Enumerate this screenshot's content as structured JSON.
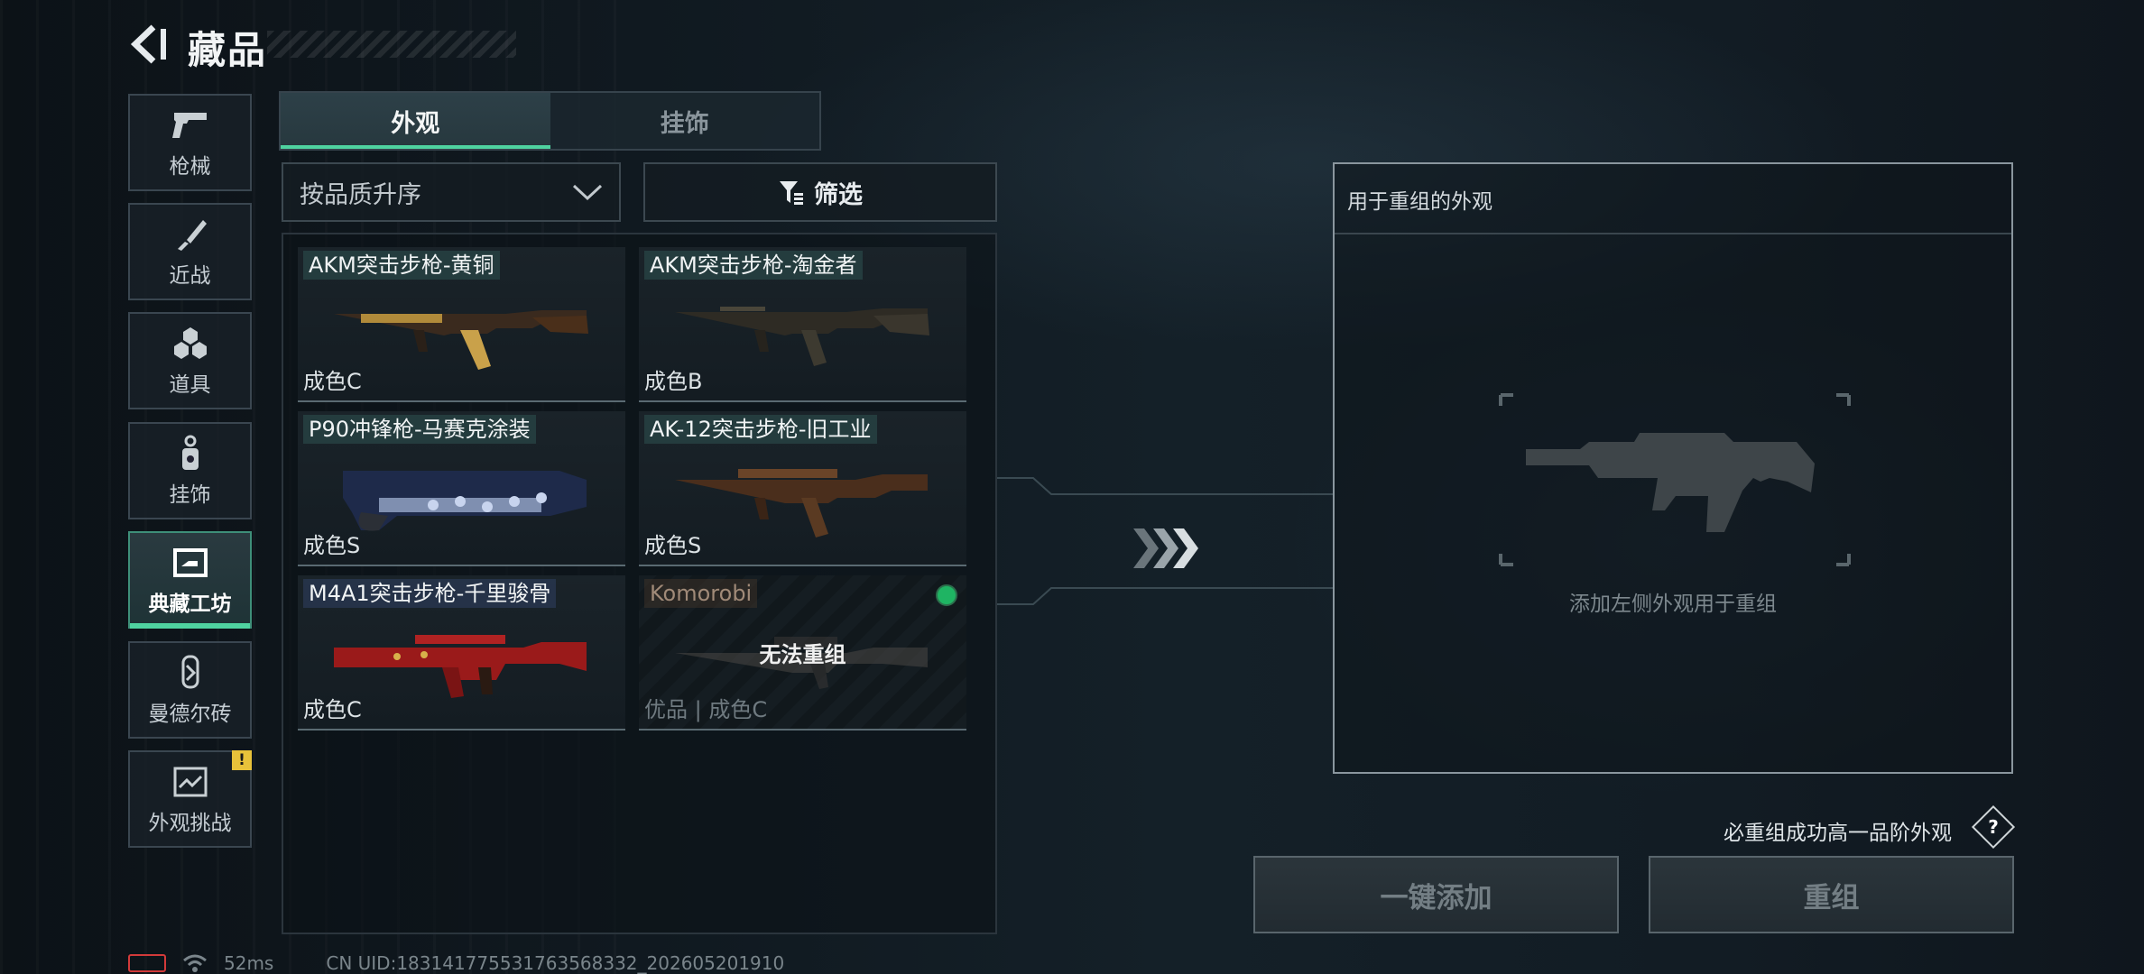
{
  "header": {
    "title": "藏品"
  },
  "sidebar": {
    "items": [
      {
        "label": "枪械",
        "icon": "pistol-icon"
      },
      {
        "label": "近战",
        "icon": "knife-icon"
      },
      {
        "label": "道具",
        "icon": "grenades-icon"
      },
      {
        "label": "挂饰",
        "icon": "charm-icon"
      },
      {
        "label": "典藏工坊",
        "icon": "workshop-icon",
        "active": true
      },
      {
        "label": "曼德尔砖",
        "icon": "mandel-brick-icon"
      },
      {
        "label": "外观挑战",
        "icon": "challenge-icon",
        "badge": "!"
      }
    ]
  },
  "tabs": [
    {
      "label": "外观",
      "active": true
    },
    {
      "label": "挂饰"
    }
  ],
  "sort": {
    "label": "按品质升序"
  },
  "filter": {
    "label": "筛选"
  },
  "items": [
    {
      "name": "AKM突击步枪-黄铜",
      "grade": "成色C"
    },
    {
      "name": "AKM突击步枪-淘金者",
      "grade": "成色B"
    },
    {
      "name": "P90冲锋枪-马赛克涂装",
      "grade": "成色S"
    },
    {
      "name": "AK-12突击步枪-旧工业",
      "grade": "成色S"
    },
    {
      "name": "M4A1突击步枪-千里骏骨",
      "grade": "成色C"
    },
    {
      "name": "Komorobi",
      "grade": "优品 | 成色C",
      "overlay": "无法重组"
    }
  ],
  "recombine": {
    "title": "用于重组的外观",
    "hint": "添加左侧外观用于重组",
    "upgrade_note": "必重组成功高一品阶外观",
    "help": "?",
    "add_all": "一键添加",
    "recombine": "重组"
  },
  "status": {
    "ping": "52ms",
    "uid": "CN UID:18314177553176356833​2_202605201910"
  },
  "colors": {
    "accent": "#4fd3a0",
    "badge": "#e8c23a",
    "active_dot": "#1fb463"
  }
}
